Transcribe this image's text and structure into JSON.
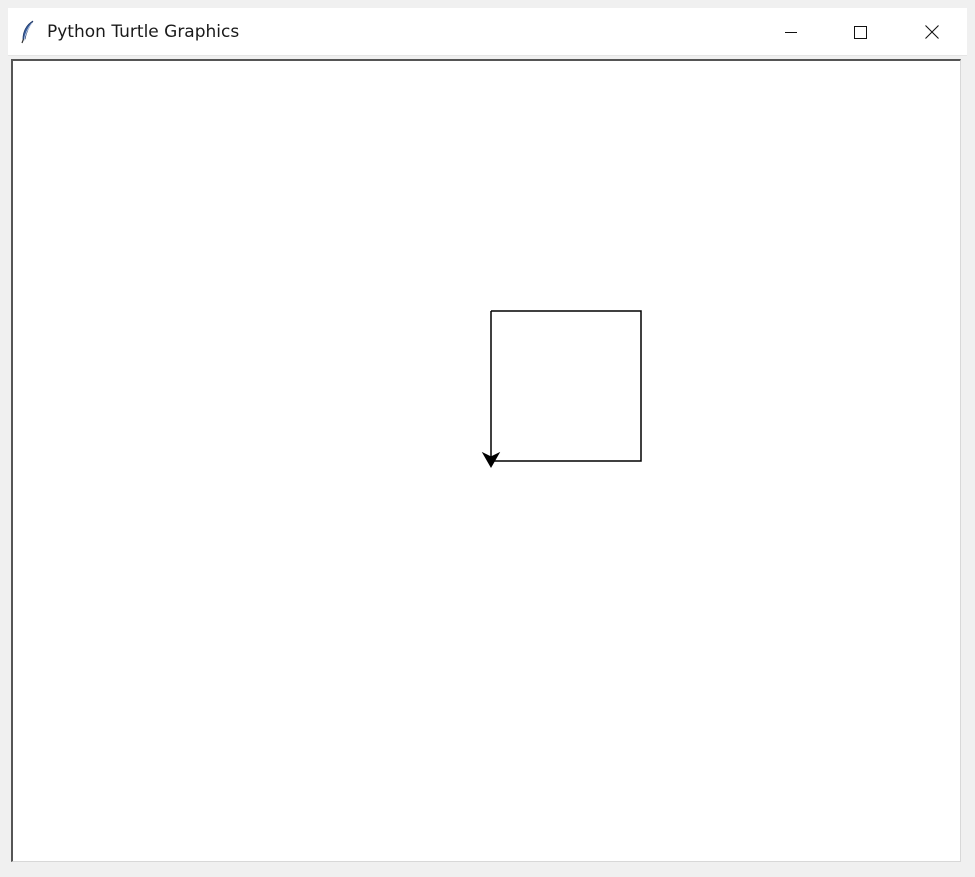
{
  "window": {
    "title": "Python Turtle Graphics"
  },
  "icons": {
    "app": "feather-icon",
    "minimize": "minimize-icon",
    "maximize": "maximize-icon",
    "close": "close-icon",
    "turtle": "arrow-turtle-cursor-icon"
  },
  "colors": {
    "pen": "#000000",
    "canvas_background": "#ffffff"
  },
  "turtle": {
    "heading": "down",
    "shape": "arrow"
  }
}
